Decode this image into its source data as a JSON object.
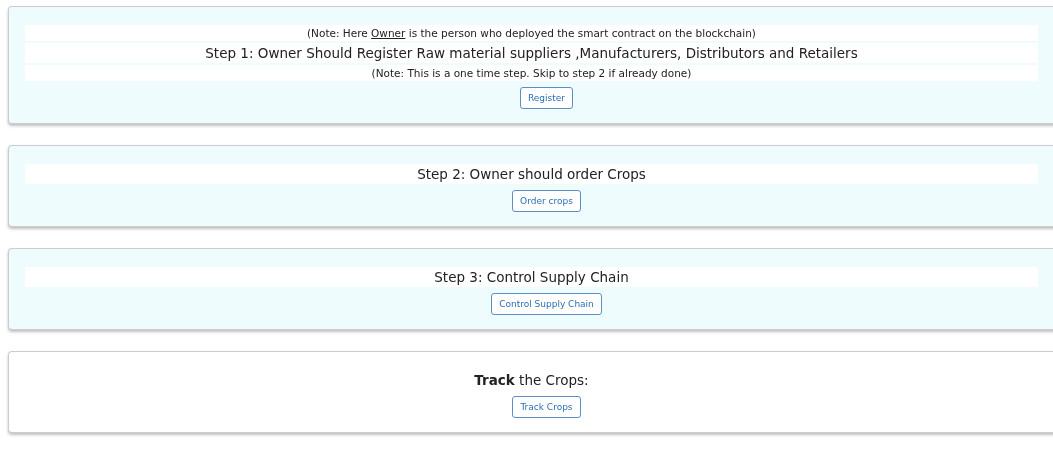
{
  "cards": [
    {
      "tinted": true,
      "lines": [
        {
          "kind": "note",
          "before": "(Note: Here ",
          "underlined": "Owner",
          "after": " is the person who deployed the smart contract on the blockchain)"
        },
        {
          "kind": "heading",
          "text": "Step 1: Owner Should Register Raw material suppliers ,Manufacturers, Distributors and Retailers"
        },
        {
          "kind": "note",
          "text": "(Note: This is a one time step. Skip to step 2 if already done)"
        }
      ],
      "button": "Register"
    },
    {
      "tinted": true,
      "lines": [
        {
          "kind": "heading",
          "text": "Step 2: Owner should order Crops"
        }
      ],
      "button": "Order crops"
    },
    {
      "tinted": true,
      "lines": [
        {
          "kind": "heading",
          "text": "Step 3: Control Supply Chain"
        }
      ],
      "button": "Control Supply Chain"
    },
    {
      "tinted": false,
      "lines": [
        {
          "kind": "heading",
          "text": "**Track** the Crops:"
        }
      ],
      "button": "Track Crops"
    }
  ]
}
